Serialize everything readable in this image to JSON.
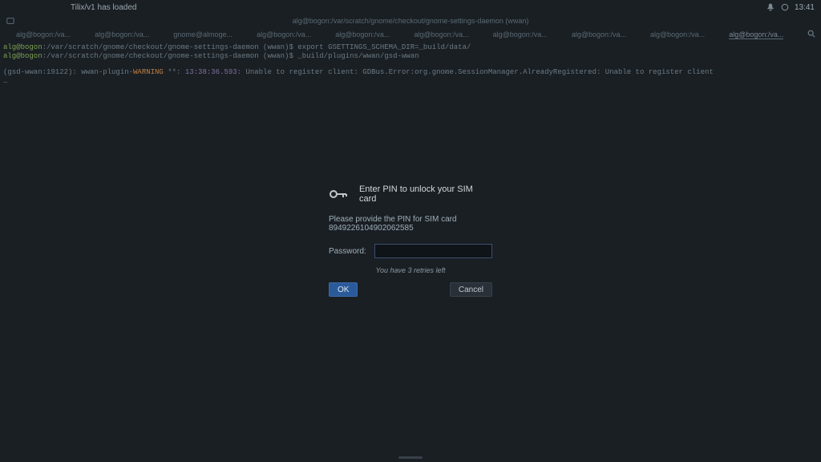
{
  "topbar": {
    "activities": "Tilix/v1 has loaded",
    "clock": "13:41"
  },
  "window": {
    "path": "alg@bogon:/var/scratch/gnome/checkout/gnome-settings-daemon (wwan)"
  },
  "tabs": [
    {
      "label": "alg@bogon:/va..."
    },
    {
      "label": "alg@bogon:/va..."
    },
    {
      "label": "gnome@almoge..."
    },
    {
      "label": "alg@bogon:/va..."
    },
    {
      "label": "alg@bogon:/va..."
    },
    {
      "label": "alg@bogon:/va..."
    },
    {
      "label": "alg@bogon:/va..."
    },
    {
      "label": "alg@bogon:/va..."
    },
    {
      "label": "alg@bogon:/va..."
    },
    {
      "label": "alg@bogon:/va..."
    }
  ],
  "terminal": {
    "line1_prompt": "alg@bogon",
    "line1_path": ":/var/scratch/gnome/checkout/gnome-settings-daemon (wwan)$ ",
    "line1_cmd": "export GSETTINGS_SCHEMA_DIR=_build/data/",
    "line2_prompt": "alg@bogon",
    "line2_path": ":/var/scratch/gnome/checkout/gnome-settings-daemon (wwan)$ ",
    "line2_cmd": "_build/plugins/wwan/gsd-wwan",
    "line3_prefix": "(gsd-wwan:19122): wwan-plugin-",
    "line3_warning": "WARNING",
    "line3_sep": " **: ",
    "line3_time": "13:38:36.593",
    "line3_msg": ": Unable to register client: GDBus.Error:org.gnome.SessionManager.AlreadyRegistered: Unable to register client",
    "line4": "_"
  },
  "dialog": {
    "title": "Enter PIN to unlock your SIM card",
    "subtitle": "Please provide the PIN for SIM card 8949226104902062585",
    "password_label": "Password:",
    "password_value": "",
    "hint": "You have 3 retries left",
    "ok_label": "OK",
    "cancel_label": "Cancel"
  }
}
